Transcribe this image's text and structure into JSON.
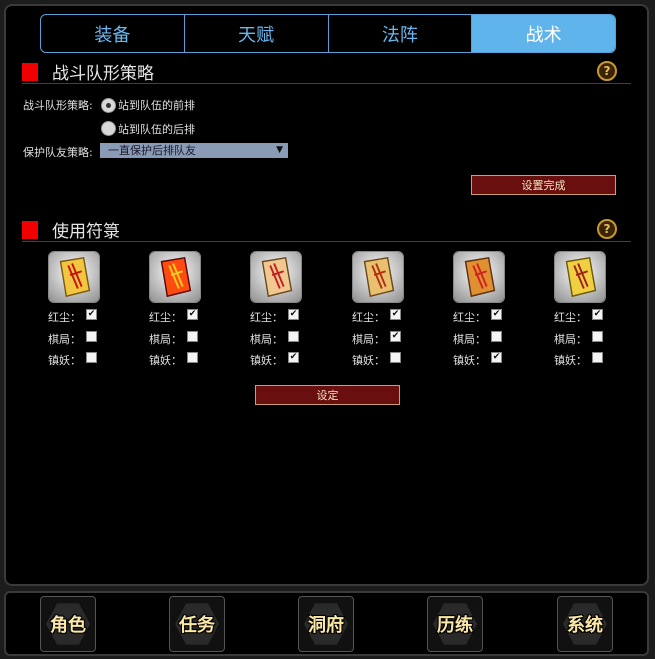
{
  "tabs": [
    {
      "label": "装备",
      "active": false
    },
    {
      "label": "天赋",
      "active": false
    },
    {
      "label": "法阵",
      "active": false
    },
    {
      "label": "战术",
      "active": true
    }
  ],
  "formation": {
    "title": "战斗队形策略",
    "help": "?",
    "strategy_label": "战斗队形策略:",
    "option_front": "站到队伍的前排",
    "option_back": "站到队伍的后排",
    "selected": "front",
    "protect_label": "保护队友策略:",
    "protect_value": "一直保护后排队友",
    "done_button": "设置完成"
  },
  "talisman": {
    "title": "使用符箓",
    "help": "?",
    "row_labels": [
      "红尘：",
      "棋局：",
      "镇妖："
    ],
    "items": [
      {
        "icon": "talisman-scroll-1-icon",
        "checks": [
          true,
          false,
          false
        ]
      },
      {
        "icon": "talisman-scroll-2-icon",
        "checks": [
          true,
          false,
          false
        ]
      },
      {
        "icon": "talisman-scroll-3-icon",
        "checks": [
          true,
          false,
          true
        ]
      },
      {
        "icon": "talisman-scroll-4-icon",
        "checks": [
          true,
          true,
          false
        ]
      },
      {
        "icon": "talisman-scroll-5-icon",
        "checks": [
          true,
          false,
          true
        ]
      },
      {
        "icon": "talisman-scroll-6-icon",
        "checks": [
          true,
          false,
          false
        ]
      }
    ],
    "set_button": "设定"
  },
  "bottom_nav": [
    {
      "label": "角色"
    },
    {
      "label": "任务"
    },
    {
      "label": "洞府"
    },
    {
      "label": "历练"
    },
    {
      "label": "系统"
    }
  ]
}
